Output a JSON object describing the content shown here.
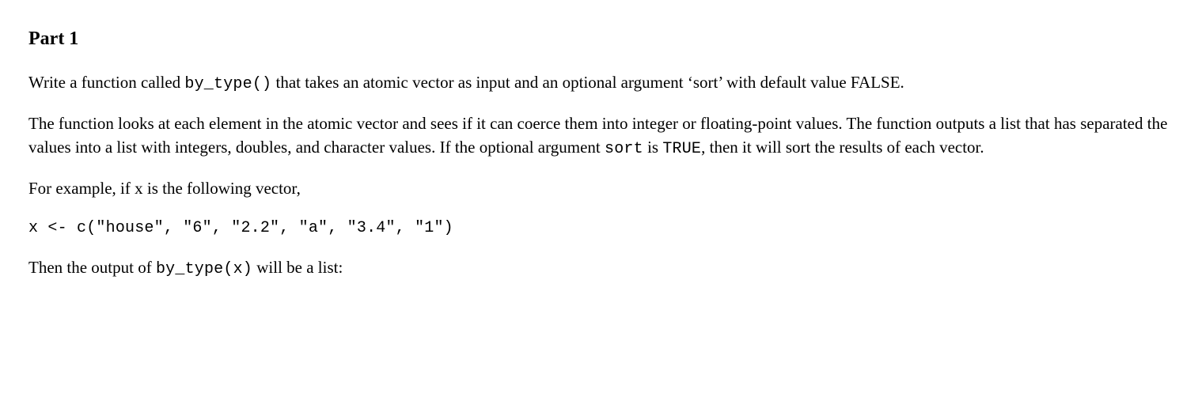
{
  "heading": "Part 1",
  "p1_a": "Write a function called ",
  "p1_code": "by_type()",
  "p1_b": " that takes an atomic vector as input and an optional argument ‘sort’ with default value FALSE.",
  "p2_a": "The function looks at each element in the atomic vector and sees if it can coerce them into integer or floating-point values. The function outputs a list that has separated the values into a list with integers, doubles, and character values. If the optional argument ",
  "p2_code1": "sort",
  "p2_b": " is ",
  "p2_code2": "TRUE",
  "p2_c": ", then it will sort the results of each vector.",
  "p3": "For example, if x is the following vector,",
  "codeblock": "x <- c(\"house\", \"6\", \"2.2\", \"a\", \"3.4\", \"1\")",
  "p4_a": "Then the output of ",
  "p4_code": "by_type(x)",
  "p4_b": " will be a list:"
}
